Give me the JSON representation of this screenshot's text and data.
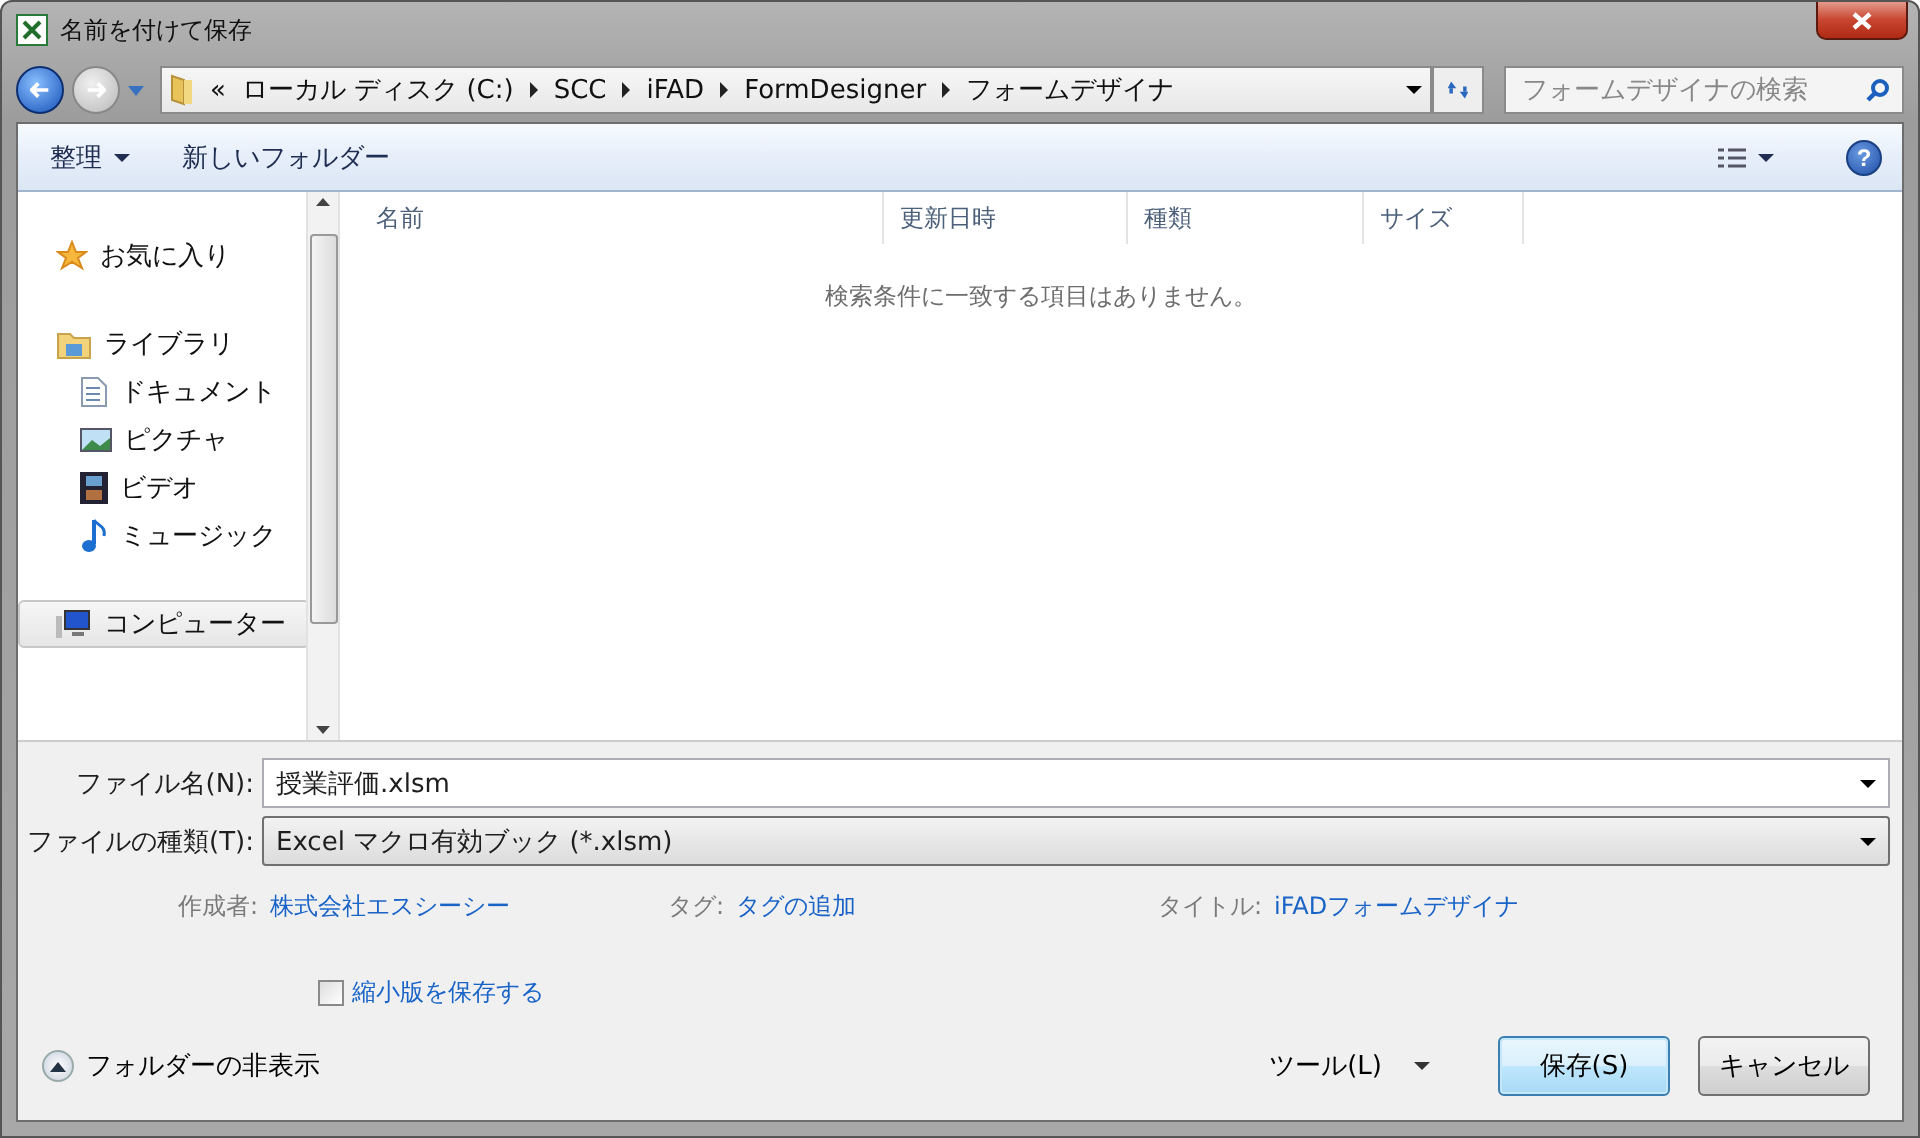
{
  "window": {
    "title": "名前を付けて保存"
  },
  "address_bar": {
    "overflow": "«",
    "segments": [
      "ローカル ディスク (C:)",
      "SCC",
      "iFAD",
      "FormDesigner",
      "フォームデザイナ"
    ]
  },
  "search": {
    "placeholder": "フォームデザイナの検索"
  },
  "toolbar": {
    "organize": "整理",
    "new_folder": "新しいフォルダー",
    "help": "?"
  },
  "sidebar": {
    "items": [
      {
        "label": "お気に入り",
        "kind": "favorites",
        "selected": false
      },
      {
        "label": "ライブラリ",
        "kind": "library",
        "selected": false,
        "children": [
          {
            "label": "ドキュメント",
            "kind": "documents",
            "selected": false
          },
          {
            "label": "ピクチャ",
            "kind": "pictures",
            "selected": false
          },
          {
            "label": "ビデオ",
            "kind": "video",
            "selected": false
          },
          {
            "label": "ミュージック",
            "kind": "music",
            "selected": false
          }
        ]
      },
      {
        "label": "コンピューター",
        "kind": "computer",
        "selected": true
      }
    ]
  },
  "file_list": {
    "columns": [
      "名前",
      "更新日時",
      "種類",
      "サイズ"
    ],
    "empty_message": "検索条件に一致する項目はありません。"
  },
  "form": {
    "file_name": {
      "label": "ファイル名(N):",
      "value": "授業評価.xlsm"
    },
    "file_type": {
      "label": "ファイルの種類(T):",
      "value": "Excel マクロ有効ブック (*.xlsm)"
    },
    "metadata": [
      {
        "label": "作成者:",
        "value": "株式会社エスシーシー"
      },
      {
        "label": "タグ:",
        "value": "タグの追加"
      },
      {
        "label": "タイトル:",
        "value": "iFADフォームデザイナ"
      }
    ],
    "thumbnail": {
      "label": "縮小版を保存する",
      "checked": false
    }
  },
  "footer": {
    "hide_folders": "フォルダーの非表示",
    "tools": "ツール(L)",
    "buttons": [
      {
        "label": "保存(S)",
        "kind": "primary"
      },
      {
        "label": "キャンセル",
        "kind": "normal"
      }
    ]
  }
}
